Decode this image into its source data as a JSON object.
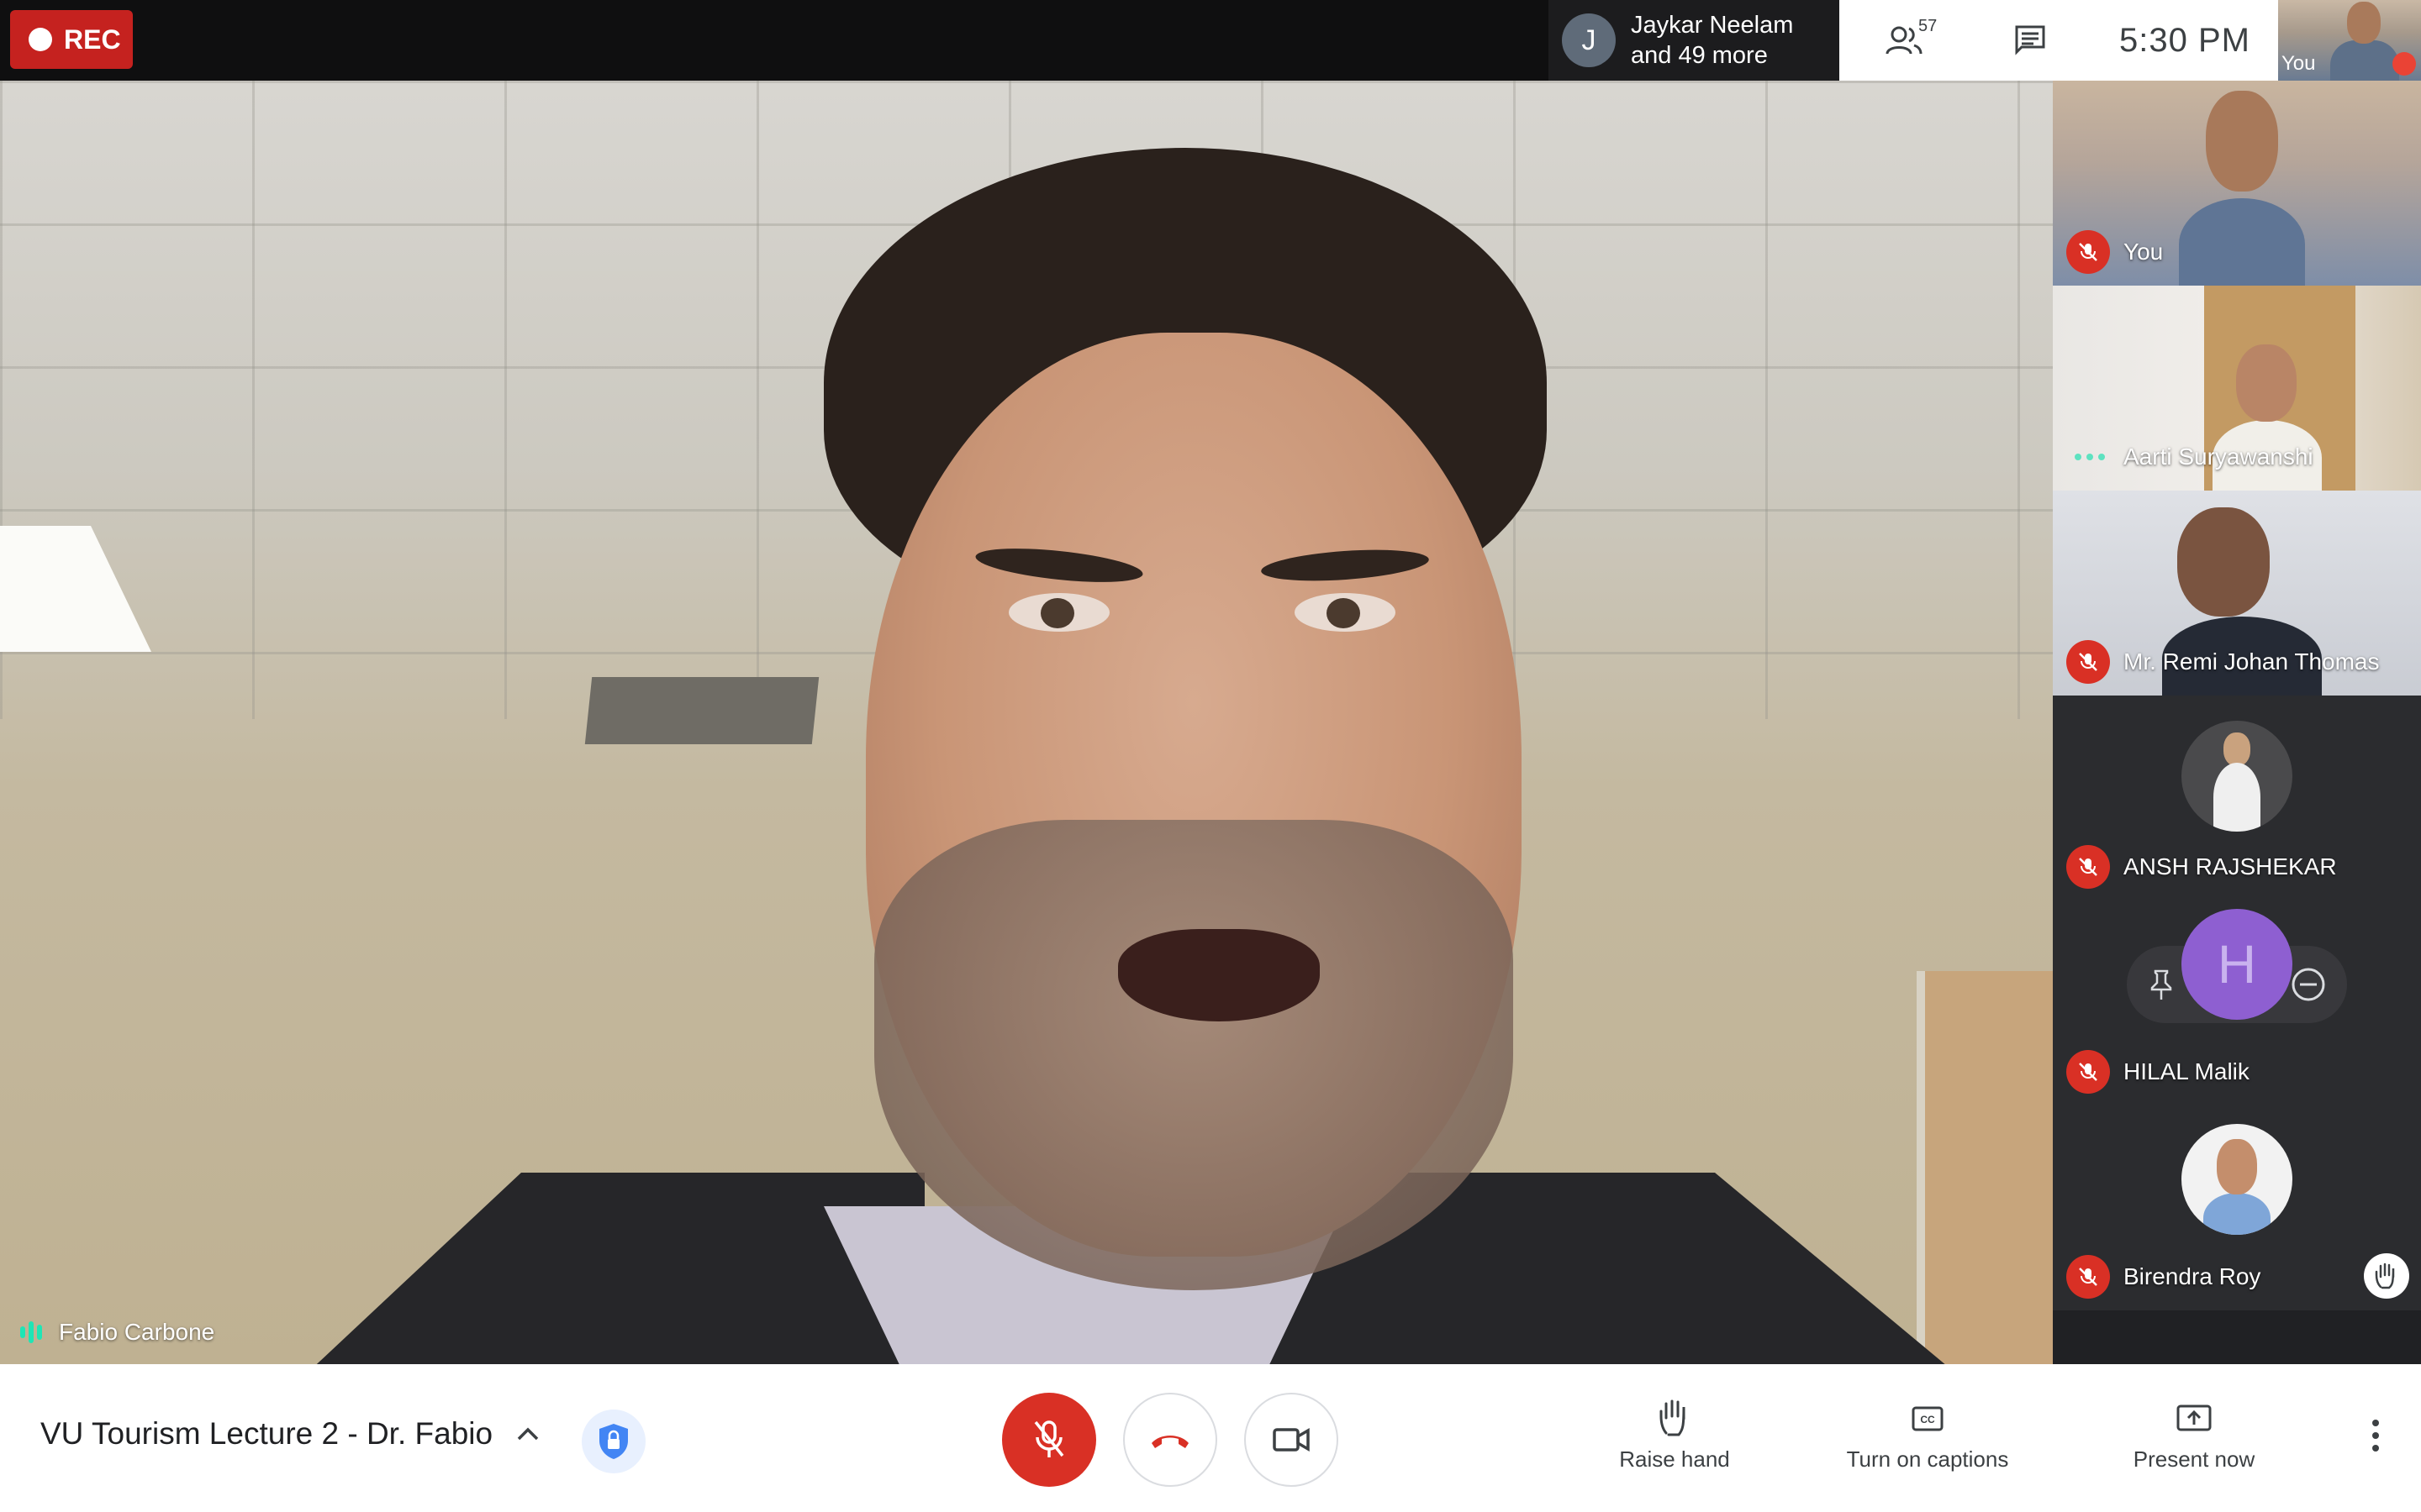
{
  "recording": {
    "label": "REC"
  },
  "presenter_chip": {
    "initial": "J",
    "line1": "Jaykar Neelam",
    "line2": "and 49 more"
  },
  "header": {
    "participant_count": "57",
    "time": "5:30  PM",
    "self_label": "You"
  },
  "main_speaker": {
    "name": "Fabio Carbone"
  },
  "tiles": [
    {
      "name": "You",
      "muted": true
    },
    {
      "name": "Aarti Suryawanshi",
      "speaking": true
    },
    {
      "name": "Mr. Remi Johan Thomas",
      "muted": true
    },
    {
      "name": "ANSH RAJSHEKAR",
      "muted": true
    },
    {
      "name": "HILAL Malik",
      "muted": true,
      "initial": "H"
    },
    {
      "name": "Birendra Roy",
      "muted": true,
      "hand_raised": true
    }
  ],
  "bottom": {
    "meeting_title": "VU Tourism Lecture 2 - Dr. Fabio",
    "raise_hand": "Raise hand",
    "captions": "Turn on captions",
    "present": "Present now"
  },
  "colors": {
    "red": "#d93025",
    "speaking_green": "#1ee6b5",
    "hilal_purple": "#8e5fd1"
  },
  "icons": [
    "people-icon",
    "chat-icon",
    "mic-off-icon",
    "hangup-icon",
    "camera-icon",
    "hand-icon",
    "captions-icon",
    "present-icon",
    "more-vert-icon",
    "shield-icon",
    "chevron-up-icon",
    "pin-icon",
    "remove-icon"
  ]
}
